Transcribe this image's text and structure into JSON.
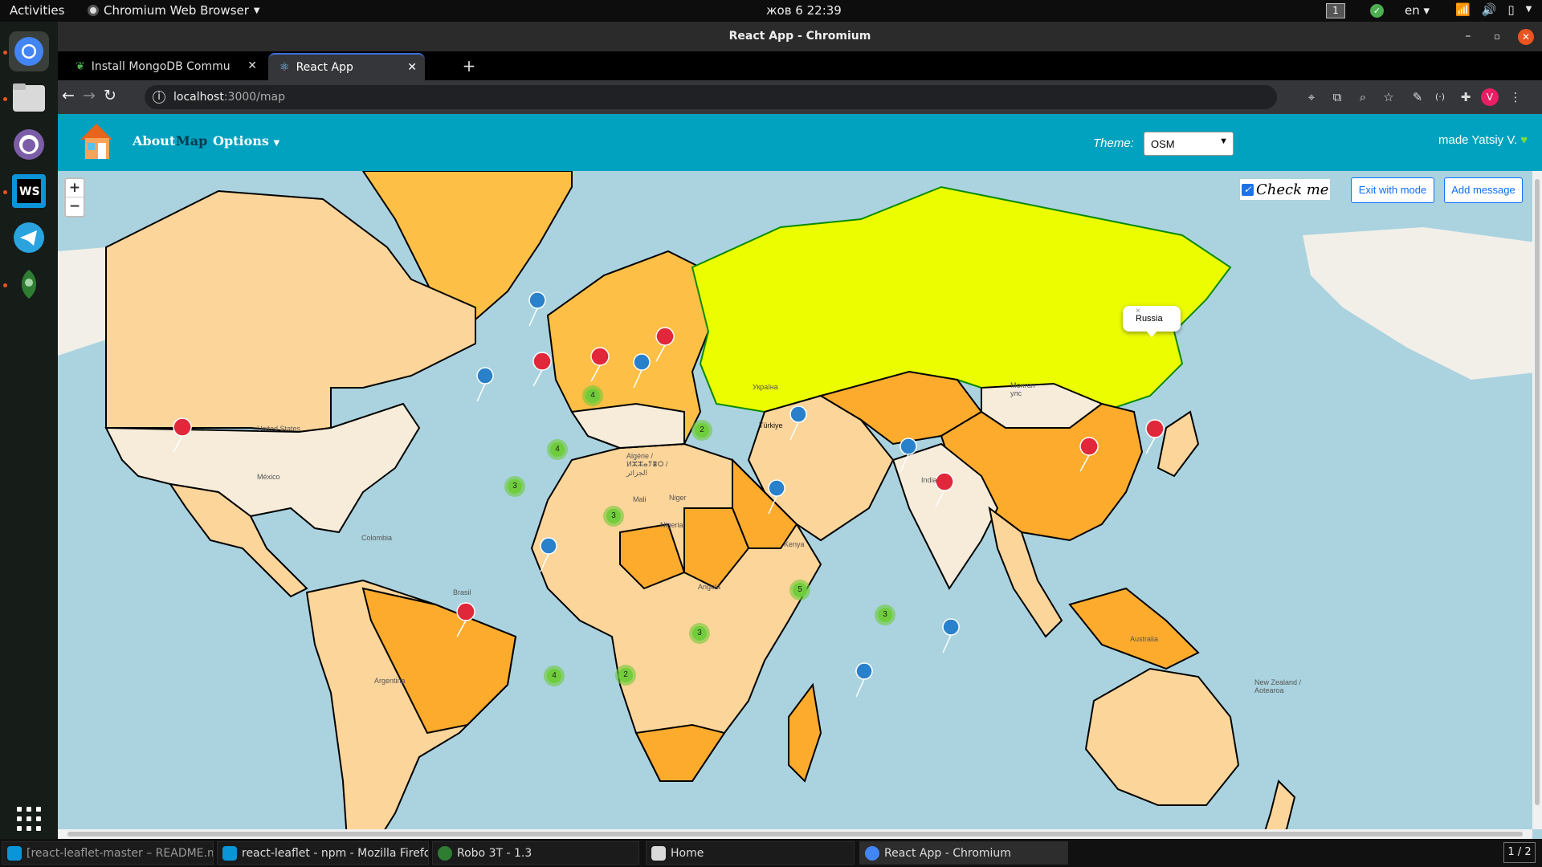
{
  "system": {
    "activities": "Activities",
    "app_name": "Chromium Web Browser",
    "clock": "жов 6  22:39",
    "workspace": "1",
    "language": "en"
  },
  "window": {
    "title": "React App - Chromium"
  },
  "tabs": [
    {
      "label": "Install MongoDB Commu",
      "active": false
    },
    {
      "label": "React App",
      "active": true
    }
  ],
  "address": {
    "host": "localhost",
    "path": ":3000/map"
  },
  "profile_initial": "V",
  "navbar": {
    "about": "About",
    "map": "Map",
    "options": "Options",
    "theme_label": "Theme:",
    "theme_value": "OSM",
    "made_by": "made Yatsiy V."
  },
  "map": {
    "zoom_in": "+",
    "zoom_out": "−",
    "checkbox_label": "Check me",
    "exit_button": "Exit with mode",
    "add_button": "Add message",
    "popup_text": "Russia",
    "popup_close": "×",
    "clusters": [
      "4",
      "2",
      "4",
      "3",
      "3",
      "5",
      "3",
      "3",
      "4",
      "2"
    ],
    "country_labels": [
      "United States",
      "México",
      "Brasil",
      "India",
      "Australia",
      "Türkiye",
      "Україна",
      "Монгол улс",
      "Algérie / ⵍⵣⵣⴰⵢⴻⵔ / الجزائر",
      "Niger",
      "Nigeria",
      "Angola",
      "Kenya",
      "Argentina",
      "New Zealand / Aotearoa",
      "Colombia",
      "Mali"
    ]
  },
  "taskbar": [
    "[react-leaflet-master – README.md]",
    "react-leaflet - npm - Mozilla Firefox",
    "Robo 3T - 1.3",
    "Home",
    "React App - Chromium"
  ],
  "pager": "1 / 2"
}
